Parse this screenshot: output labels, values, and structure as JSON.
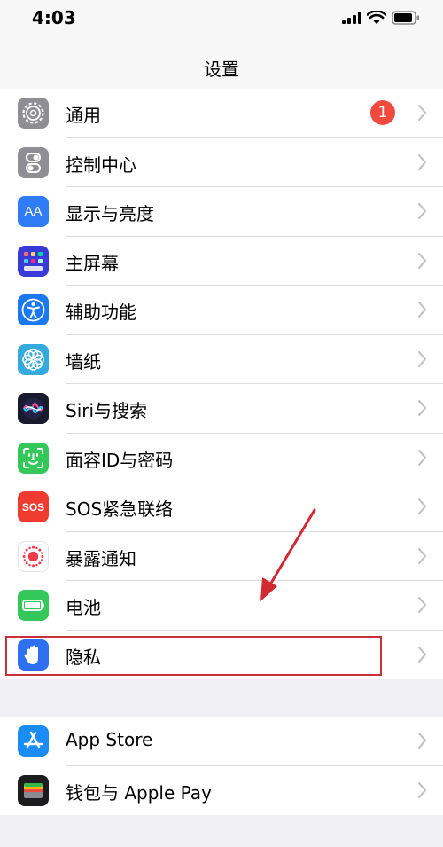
{
  "status_bar": {
    "time": "4:03",
    "icons": [
      "signal-icon",
      "wifi-icon",
      "battery-icon"
    ]
  },
  "nav": {
    "title": "设置"
  },
  "group_one": [
    {
      "label": "通用",
      "icon": "gear-icon",
      "badge": "1"
    },
    {
      "label": "控制中心",
      "icon": "control-center-icon"
    },
    {
      "label": "显示与亮度",
      "icon": "display-brightness-icon",
      "icon_text": "AA"
    },
    {
      "label": "主屏幕",
      "icon": "home-screen-icon"
    },
    {
      "label": "辅助功能",
      "icon": "accessibility-icon"
    },
    {
      "label": "墙纸",
      "icon": "wallpaper-icon"
    },
    {
      "label": "Siri与搜索",
      "icon": "siri-icon"
    },
    {
      "label": "面容ID与密码",
      "icon": "face-id-icon"
    },
    {
      "label": "SOS紧急联络",
      "icon": "sos-icon",
      "icon_text": "SOS"
    },
    {
      "label": "暴露通知",
      "icon": "exposure-notification-icon"
    },
    {
      "label": "电池",
      "icon": "battery-setting-icon"
    },
    {
      "label": "隐私",
      "icon": "privacy-hand-icon"
    }
  ],
  "group_two": [
    {
      "label": "App Store",
      "icon": "app-store-icon"
    },
    {
      "label": "钱包与 Apple Pay",
      "icon": "wallet-icon"
    }
  ],
  "colors": {
    "background": "#efeff4",
    "badge": "#f0493e",
    "annotation": "#c8313a",
    "chevron": "#c4c4c7"
  }
}
